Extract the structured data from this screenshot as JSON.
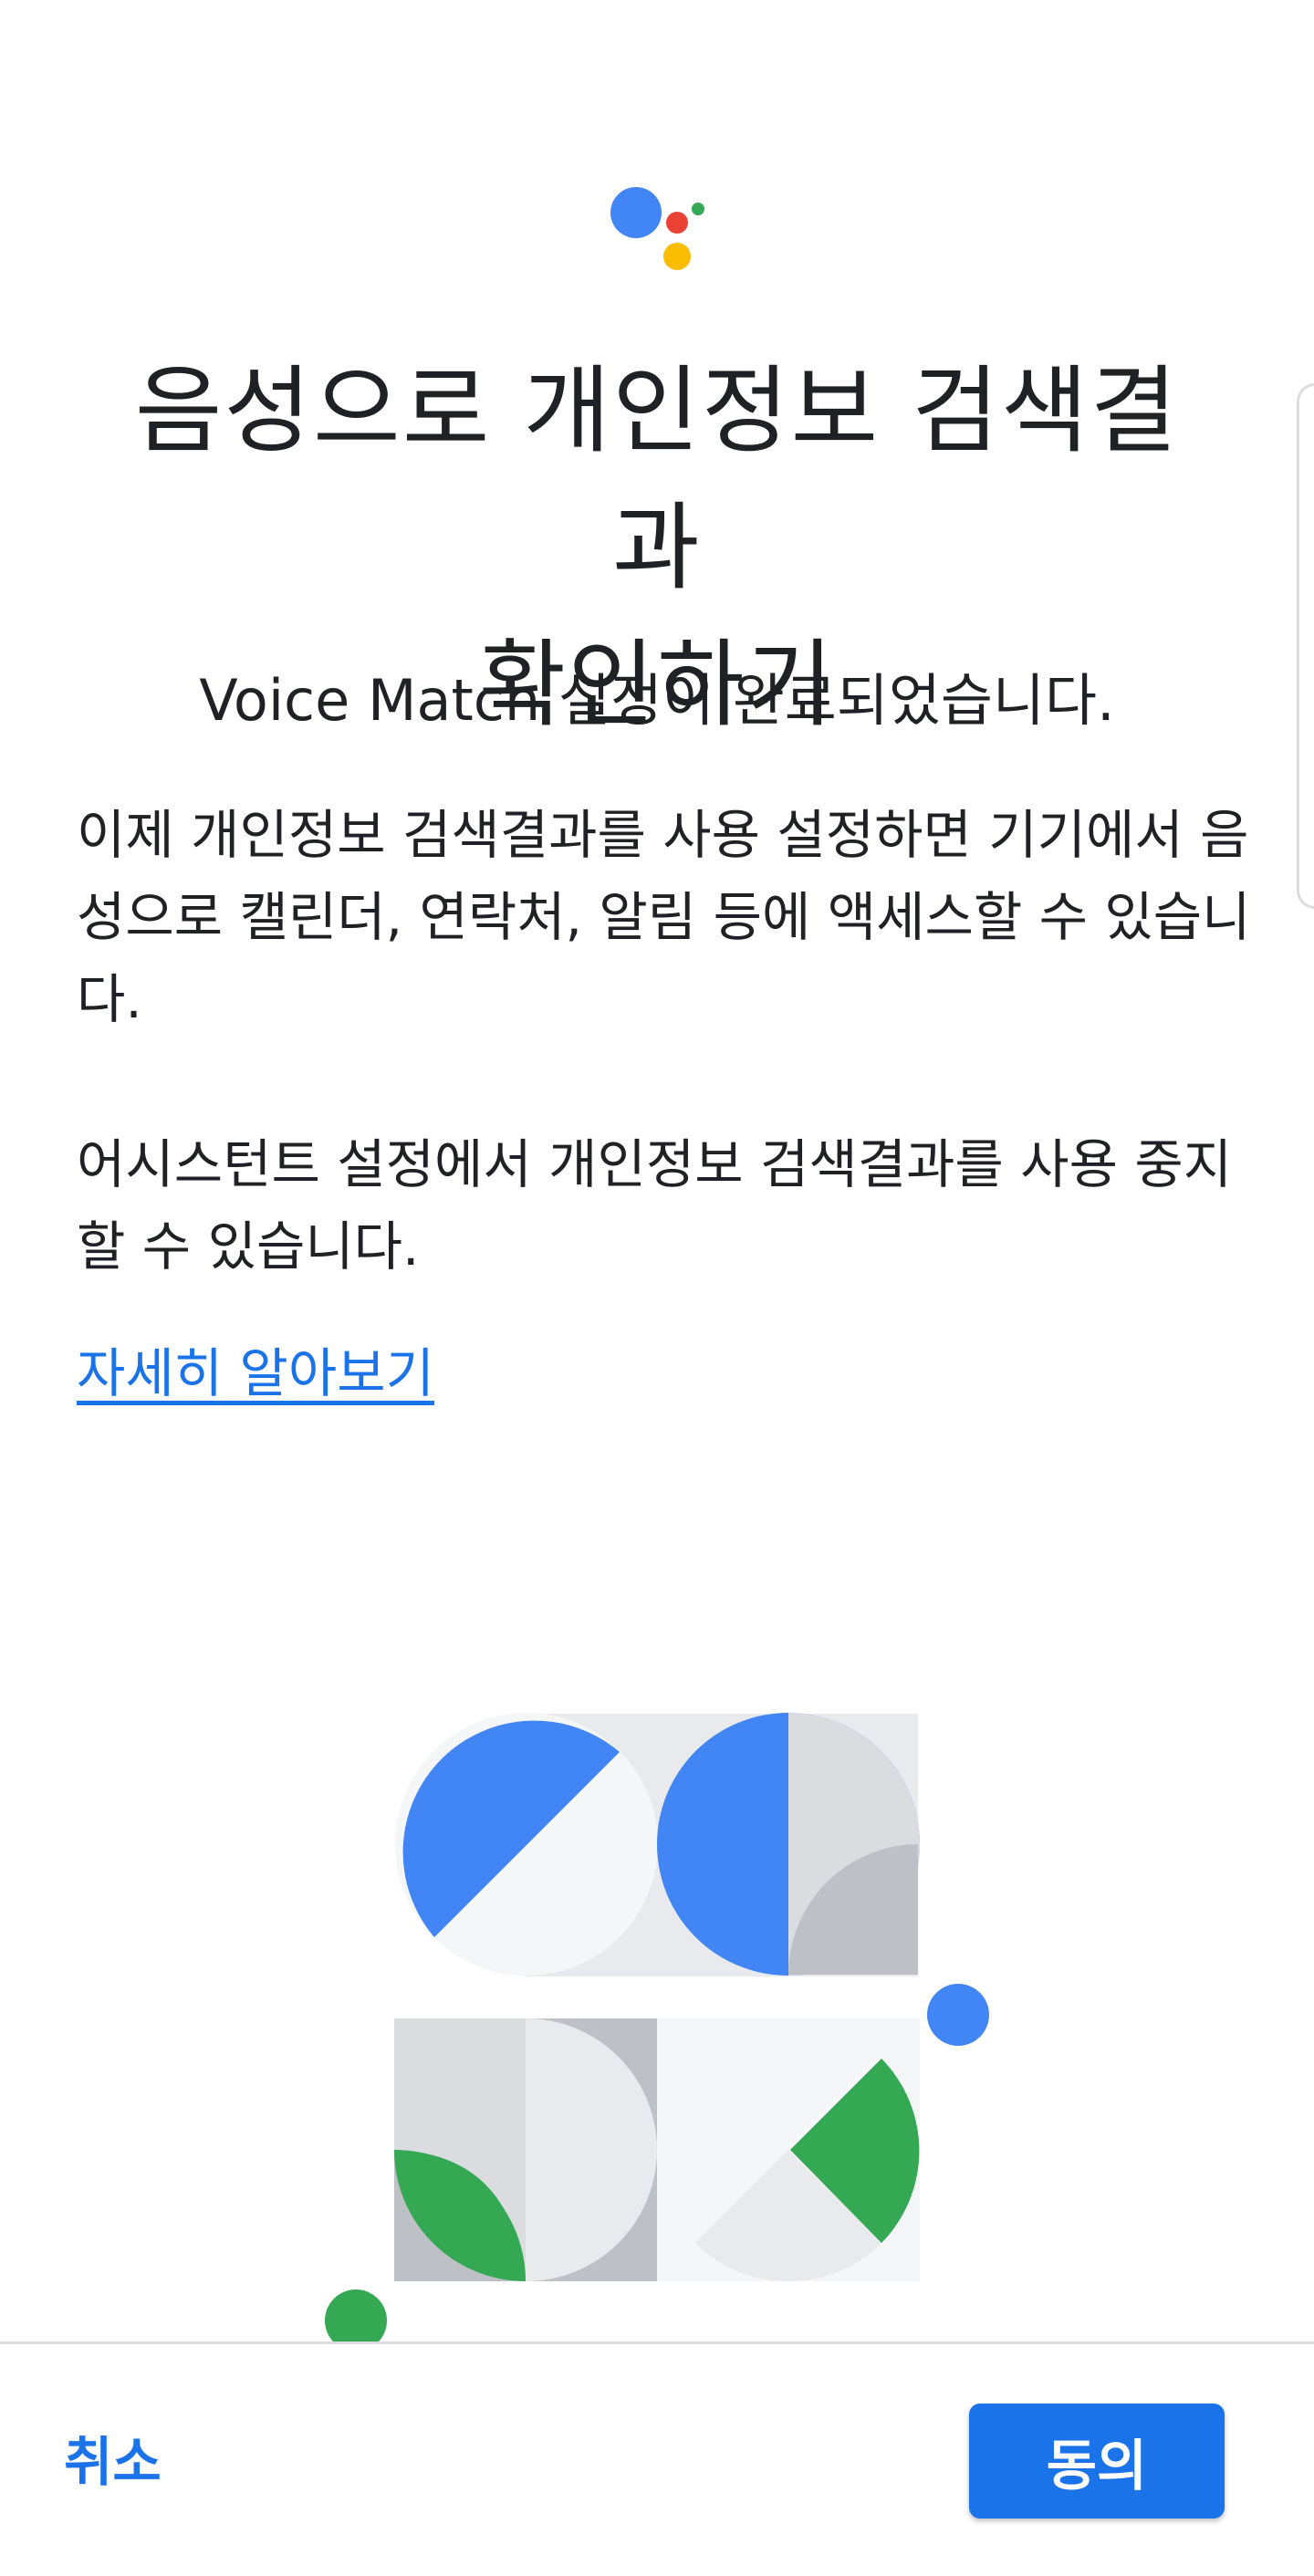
{
  "header": {
    "logo_icon": "google-assistant-logo",
    "title_line1": "음성으로 개인정보 검색결과",
    "title_line2": "확인하기",
    "subtitle": "Voice Match 설정이 완료되었습니다."
  },
  "body": {
    "paragraph1": "이제 개인정보 검색결과를 사용 설정하면 기기에서 음성으로 캘린더, 연락처, 알림 등에 액세스할 수 있습니다.",
    "paragraph2": "어시스턴트 설정에서 개인정보 검색결과를 사용 중지할 수 있습니다.",
    "learn_more_link": "자세히 알아보기"
  },
  "illustration": {
    "icon": "abstract-shapes-illustration",
    "colors": {
      "blue": "#4285f4",
      "green": "#34a853",
      "light_gray": "#e8eaed",
      "mid_gray": "#bdc1c6",
      "off_white": "#f5f6f8"
    }
  },
  "footer": {
    "cancel_label": "취소",
    "agree_label": "동의"
  },
  "colors": {
    "accent": "#1a73e8",
    "text": "#202124",
    "divider": "#dadce0"
  }
}
